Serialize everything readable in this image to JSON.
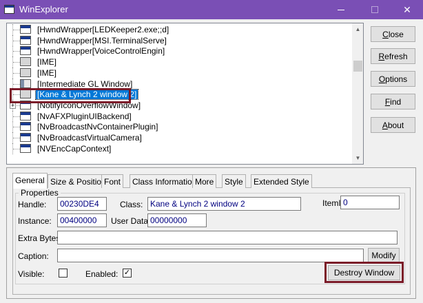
{
  "window": {
    "title": "WinExplorer",
    "controls": {
      "minimize": "—",
      "maximize": "☐",
      "close": "✕"
    }
  },
  "tree": {
    "items": [
      {
        "label": "[HwndWrapper[LEDKeeper2.exe;;d]",
        "icon": "window-icon"
      },
      {
        "label": "[HwndWrapper[MSI.TerminalServe]",
        "icon": "window-icon"
      },
      {
        "label": "[HwndWrapper[VoiceControlEngin]",
        "icon": "window-icon"
      },
      {
        "label": "[IME]",
        "icon": "blank-window-icon"
      },
      {
        "label": "[IME]",
        "icon": "blank-window-icon"
      },
      {
        "label": "[Intermediate GL Window]",
        "icon": "child-window-icon"
      },
      {
        "label": "[Kane & Lynch 2 window 2]",
        "icon": "blank-window-icon",
        "selected": true
      },
      {
        "label": "[NotifyIconOverflowWindow]",
        "icon": "window-icon",
        "expander": "+"
      },
      {
        "label": "[NvAFXPluginUIBackend]",
        "icon": "window-icon"
      },
      {
        "label": "[NvBroadcastNvContainerPlugin]",
        "icon": "window-icon"
      },
      {
        "label": "[NvBroadcastVirtualCamera]",
        "icon": "window-icon"
      },
      {
        "label": "[NVEncCapContext]",
        "icon": "window-icon"
      }
    ]
  },
  "buttons": {
    "close": {
      "pre": "",
      "u": "C",
      "post": "lose"
    },
    "refresh": {
      "pre": "",
      "u": "R",
      "post": "efresh"
    },
    "options": {
      "pre": "",
      "u": "O",
      "post": "ptions"
    },
    "find": {
      "pre": "",
      "u": "F",
      "post": "ind"
    },
    "about": {
      "pre": "",
      "u": "A",
      "post": "bout"
    }
  },
  "tabs": [
    "General",
    "Size & Position",
    "Font",
    "Class Information",
    "More",
    "Style",
    "Extended Style"
  ],
  "properties": {
    "group_label": "Properties",
    "handle_label": "Handle:",
    "handle_value": "00230DE4",
    "class_label": "Class:",
    "class_value": "Kane & Lynch 2 window 2",
    "itemid_label": "ItemID:",
    "itemid_value": "0",
    "instance_label": "Instance:",
    "instance_value": "00400000",
    "userdata_label": "User Data:",
    "userdata_value": "00000000",
    "extrabytes_label": "Extra Bytes:",
    "extrabytes_value": "",
    "caption_label": "Caption:",
    "caption_value": "",
    "modify_label": "Modify",
    "visible_label": "Visible:",
    "visible_checked": false,
    "enabled_label": "Enabled:",
    "enabled_checked": true,
    "enabled_mark": "✓",
    "destroy_label": "Destroy Window"
  },
  "colors": {
    "titlebar": "#7a4fb5",
    "selection": "#0078d7",
    "highlight_box": "#7b1a28",
    "field_text": "#000080"
  }
}
